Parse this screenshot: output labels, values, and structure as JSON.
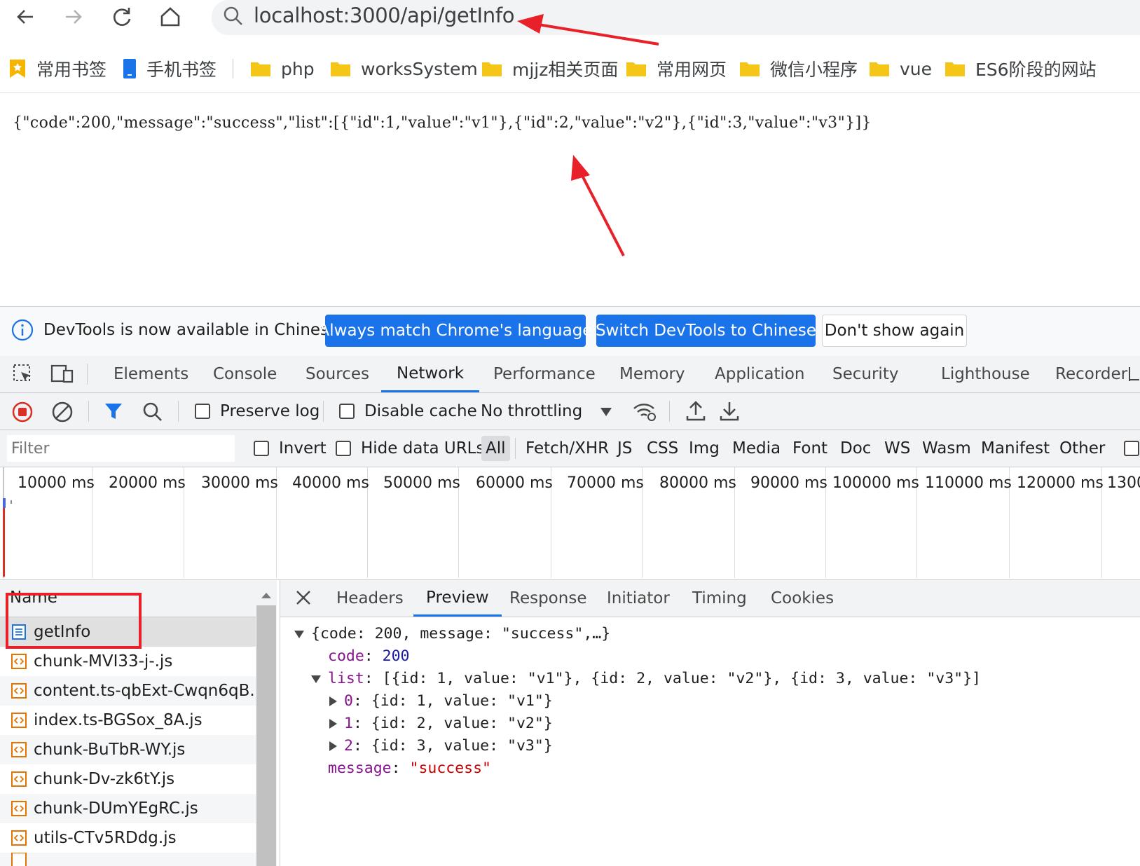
{
  "browser": {
    "url": "localhost:3000/api/getInfo",
    "nav_icons": [
      "back-icon",
      "forward-icon",
      "reload-icon",
      "home-icon"
    ]
  },
  "bookmarks": [
    {
      "label": "常用书签",
      "icon": "star-bookmark-icon"
    },
    {
      "label": "手机书签",
      "icon": "mobile-bookmark-icon"
    },
    {
      "label": "php",
      "icon": "folder-icon"
    },
    {
      "label": "worksSystem",
      "icon": "folder-icon"
    },
    {
      "label": "mjjz相关页面",
      "icon": "folder-icon"
    },
    {
      "label": "常用网页",
      "icon": "folder-icon"
    },
    {
      "label": "微信小程序",
      "icon": "folder-icon"
    },
    {
      "label": "vue",
      "icon": "folder-icon"
    },
    {
      "label": "ES6阶段的网站",
      "icon": "folder-icon"
    }
  ],
  "page": {
    "json_text": "{\"code\":200,\"message\":\"success\",\"list\":[{\"id\":1,\"value\":\"v1\"},{\"id\":2,\"value\":\"v2\"},{\"id\":3,\"value\":\"v3\"}]}"
  },
  "banner": {
    "text": "DevTools is now available in Chinese!",
    "btn_match": "Always match Chrome's language",
    "btn_switch": "Switch DevTools to Chinese",
    "btn_dismiss": "Don't show again"
  },
  "devtools_tabs": [
    "Elements",
    "Console",
    "Sources",
    "Network",
    "Performance",
    "Memory",
    "Application",
    "Security",
    "Lighthouse",
    "Recorder"
  ],
  "active_devtools_tab": "Network",
  "network_toolbar": {
    "preserve_log": "Preserve log",
    "disable_cache": "Disable cache",
    "throttling": "No throttling"
  },
  "filter": {
    "placeholder": "Filter",
    "invert": "Invert",
    "hide_data_urls": "Hide data URLs",
    "types": [
      "All",
      "Fetch/XHR",
      "JS",
      "CSS",
      "Img",
      "Media",
      "Font",
      "Doc",
      "WS",
      "Wasm",
      "Manifest",
      "Other"
    ],
    "active_type": "All"
  },
  "timeline": {
    "labels": [
      "10000 ms",
      "20000 ms",
      "30000 ms",
      "40000 ms",
      "50000 ms",
      "60000 ms",
      "70000 ms",
      "80000 ms",
      "90000 ms",
      "100000 ms",
      "110000 ms",
      "120000 ms",
      "1300"
    ]
  },
  "requests": {
    "header": "Name",
    "rows": [
      {
        "name": "getInfo",
        "type": "document"
      },
      {
        "name": "chunk-MVI33-j-.js",
        "type": "script"
      },
      {
        "name": "content.ts-qbExt-Cwqn6qB...",
        "type": "script"
      },
      {
        "name": "index.ts-BGSox_8A.js",
        "type": "script"
      },
      {
        "name": "chunk-BuTbR-WY.js",
        "type": "script"
      },
      {
        "name": "chunk-Dv-zk6tY.js",
        "type": "script"
      },
      {
        "name": "chunk-DUmYEgRC.js",
        "type": "script"
      },
      {
        "name": "utils-CTv5RDdg.js",
        "type": "script"
      }
    ]
  },
  "detail": {
    "tabs": [
      "Headers",
      "Preview",
      "Response",
      "Initiator",
      "Timing",
      "Cookies"
    ],
    "active_tab": "Preview",
    "preview": {
      "root_summary": "{code: 200, message: \"success\",…}",
      "code_key": "code",
      "code_value": "200",
      "list_key": "list",
      "list_summary": "[{id: 1, value: \"v1\"}, {id: 2, value: \"v2\"}, {id: 3, value: \"v3\"}]",
      "items": [
        {
          "index": "0",
          "summary": "{id: 1, value: \"v1\"}"
        },
        {
          "index": "1",
          "summary": "{id: 2, value: \"v2\"}"
        },
        {
          "index": "2",
          "summary": "{id: 3, value: \"v3\"}"
        }
      ],
      "message_key": "message",
      "message_value": "\"success\""
    }
  },
  "colors": {
    "accent": "#1a73e8",
    "annotation_red": "#e8202a",
    "folder_yellow": "#f5c518"
  }
}
